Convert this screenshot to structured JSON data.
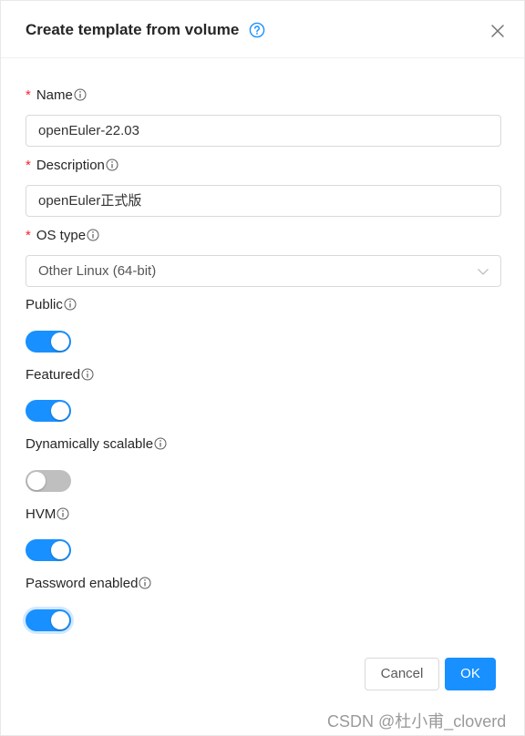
{
  "dialog": {
    "title": "Create template from volume",
    "close_label": "X"
  },
  "fields": {
    "name": {
      "required": "*",
      "label": "Name",
      "value": "openEuler-22.03"
    },
    "description": {
      "required": "*",
      "label": "Description",
      "value": "openEuler正式版"
    },
    "os_type": {
      "required": "*",
      "label": "OS type",
      "value": "Other Linux (64-bit)"
    },
    "public": {
      "label": "Public",
      "enabled": true
    },
    "featured": {
      "label": "Featured",
      "enabled": true
    },
    "dynamically_scalable": {
      "label": "Dynamically scalable",
      "enabled": false
    },
    "hvm": {
      "label": "HVM",
      "enabled": true
    },
    "password_enabled": {
      "label": "Password enabled",
      "enabled": true
    }
  },
  "footer": {
    "cancel_label": "Cancel",
    "ok_label": "OK"
  },
  "watermark": "CSDN @杜小甫_cloverd",
  "icons": {
    "help": "question-circle-icon",
    "info": "info-circle-icon",
    "close": "close-icon",
    "dropdown": "chevron-down-icon"
  },
  "colors": {
    "primary": "#1890ff",
    "required": "#f5222d",
    "switch_off": "#bfbfbf"
  }
}
